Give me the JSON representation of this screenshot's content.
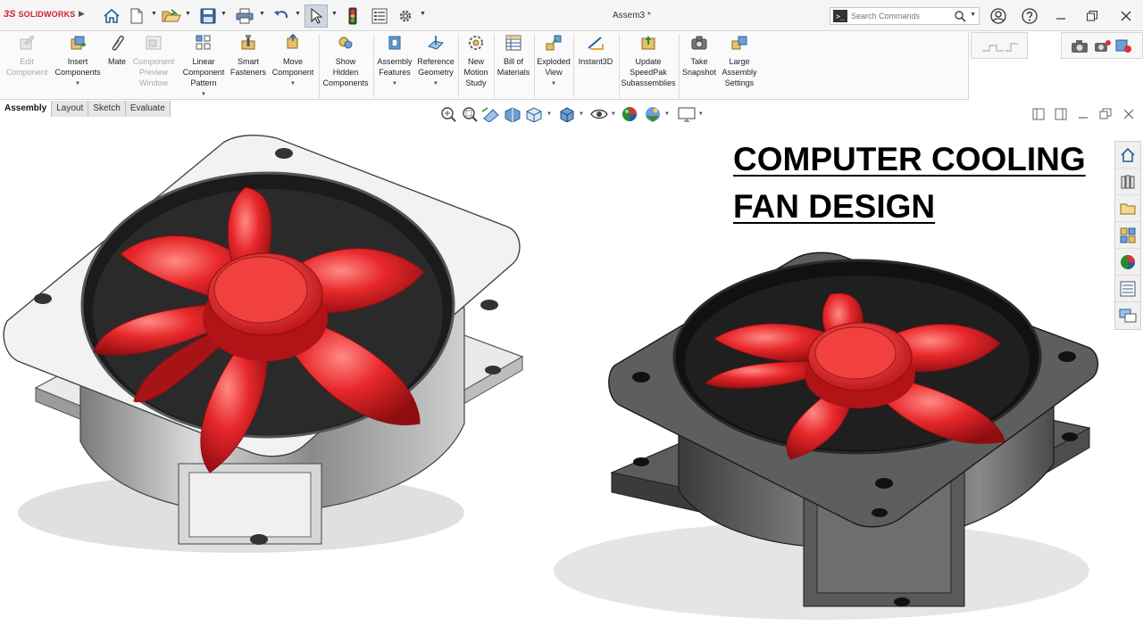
{
  "app": {
    "name": "SOLIDWORKS",
    "logo_mark": "3S",
    "document_title": "Assem3 *"
  },
  "quick_access": {
    "items": [
      "home-icon",
      "new-document-icon",
      "open-icon",
      "save-icon",
      "print-icon",
      "undo-icon",
      "select-arrow-icon",
      "rebuild-traffic-light-icon",
      "file-properties-icon",
      "options-gear-icon"
    ]
  },
  "search": {
    "placeholder": "Search Commands"
  },
  "ribbon": {
    "buttons": [
      {
        "label": "Edit\nComponent",
        "icon": "edit-component-icon",
        "disabled": true
      },
      {
        "label": "Insert\nComponents",
        "icon": "insert-components-icon",
        "disabled": false
      },
      {
        "label": "Mate",
        "icon": "mate-paperclip-icon",
        "disabled": false
      },
      {
        "label": "Component\nPreview\nWindow",
        "icon": "component-preview-icon",
        "disabled": true
      },
      {
        "label": "Linear\nComponent\nPattern",
        "icon": "linear-pattern-icon",
        "disabled": false
      },
      {
        "label": "Smart\nFasteners",
        "icon": "smart-fasteners-icon",
        "disabled": false
      },
      {
        "label": "Move\nComponent",
        "icon": "move-component-icon",
        "disabled": false
      },
      {
        "label": "Show\nHidden\nComponents",
        "icon": "show-hidden-icon",
        "disabled": false
      },
      {
        "label": "Assembly\nFeatures",
        "icon": "assembly-features-icon",
        "disabled": false
      },
      {
        "label": "Reference\nGeometry",
        "icon": "reference-geometry-icon",
        "disabled": false
      },
      {
        "label": "New\nMotion\nStudy",
        "icon": "motion-study-icon",
        "disabled": false
      },
      {
        "label": "Bill of\nMaterials",
        "icon": "bill-of-materials-icon",
        "disabled": false
      },
      {
        "label": "Exploded\nView",
        "icon": "exploded-view-icon",
        "disabled": false
      },
      {
        "label": "Instant3D",
        "icon": "instant3d-icon",
        "disabled": false
      },
      {
        "label": "Update\nSpeedPak\nSubassemblies",
        "icon": "speedpak-icon",
        "disabled": false
      },
      {
        "label": "Take\nSnapshot",
        "icon": "snapshot-camera-icon",
        "disabled": false
      },
      {
        "label": "Large\nAssembly\nSettings",
        "icon": "large-assembly-icon",
        "disabled": false
      }
    ]
  },
  "tabs": [
    {
      "label": "Assembly",
      "active": true
    },
    {
      "label": "Layout",
      "active": false
    },
    {
      "label": "Sketch",
      "active": false
    },
    {
      "label": "Evaluate",
      "active": false
    }
  ],
  "headline": {
    "line1": "COMPUTER COOLING",
    "line2": "FAN DESIGN"
  },
  "colors": {
    "accent_red": "#d3202a",
    "fan_red": "#e8282b",
    "frame_dark": "#5a5a5a",
    "frame_light": "#e6e6e6"
  }
}
